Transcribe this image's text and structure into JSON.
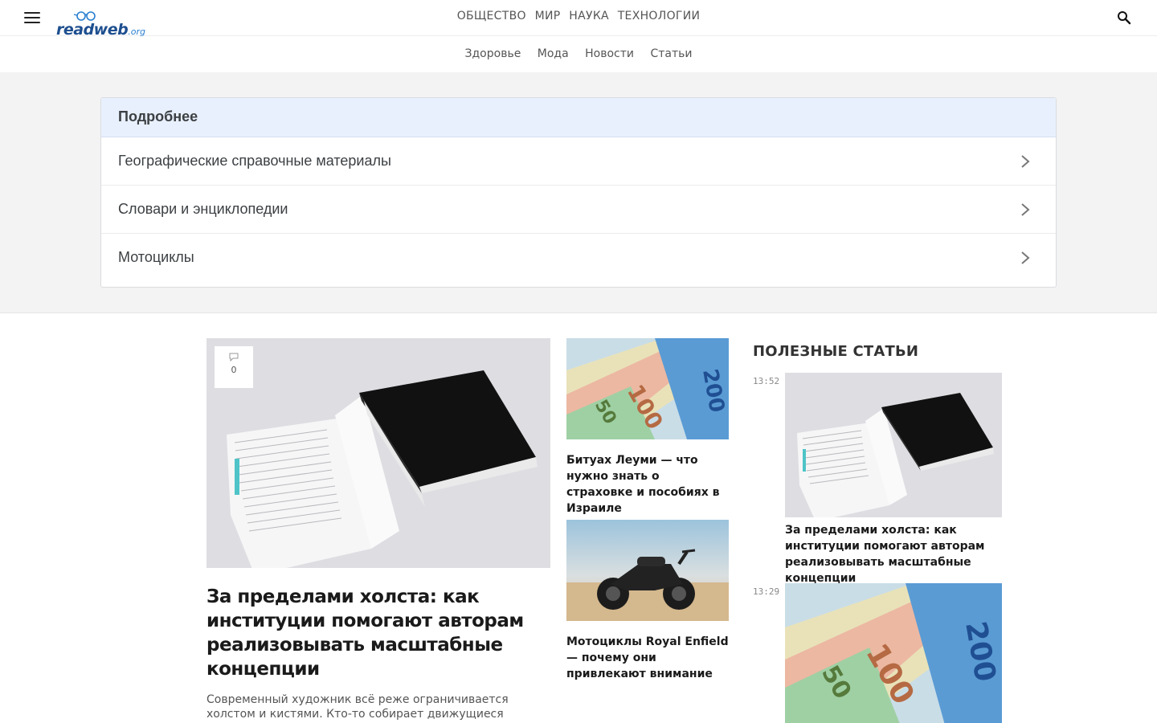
{
  "header": {
    "logo": {
      "main": "readweb",
      "suffix": ".org"
    },
    "top_nav": [
      "ОБЩЕСТВО",
      "МИР",
      "НАУКА",
      "ТЕХНОЛОГИИ"
    ],
    "sub_nav": [
      "Здоровье",
      "Мода",
      "Новости",
      "Статьи"
    ],
    "icons": {
      "menu": "hamburger-menu-icon",
      "search": "search-icon"
    }
  },
  "related": {
    "title": "Подробнее",
    "items": [
      "Географические справочные материалы",
      "Словари и энциклопедии",
      "Мотоциклы"
    ]
  },
  "featured": {
    "comments": "0",
    "title": "За пределами холста: как институции помогают авторам реализовывать масштабные концепции",
    "excerpt": "Современный художник всё реже ограничивается холстом и кистями. Кто-то собирает движущиеся конструкции, кто-то"
  },
  "mid_articles": [
    {
      "title": "Битуах Леуми — что нужно знать о страховке и пособиях в Израиле"
    },
    {
      "title": "Мотоциклы Royal Enfield — почему они привлекают внимание"
    }
  ],
  "sidebar": {
    "heading": "ПОЛЕЗНЫЕ СТАТЬИ",
    "articles": [
      {
        "time": "13:52",
        "title": "За пределами холста: как институции помогают авторам реализовывать масштабные концепции"
      },
      {
        "time": "13:29",
        "title": ""
      }
    ]
  },
  "colors": {
    "accent_band": "#e8f0fd",
    "logo_dark": "#1e4f8f",
    "logo_light": "#2a7fd0"
  }
}
